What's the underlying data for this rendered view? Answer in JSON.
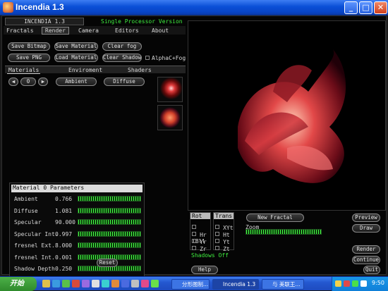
{
  "window": {
    "title": "Incendia 1.3",
    "min": "_",
    "max": "□",
    "close": "✕"
  },
  "header": {
    "app_name": "INCENDIA 1.3",
    "version": "Single Processor Version"
  },
  "menu": [
    "Fractals",
    "Render",
    "Camera",
    "Editors",
    "About"
  ],
  "toolbar": {
    "save_bitmap": "Save Bitmap",
    "save_material": "Save Material",
    "clear_fog": "Clear fog",
    "save_png": "Save PNG",
    "load_material": "Load Material",
    "clear_shadows": "Clear Shadows",
    "alpha_fog": "AlphaC+Fog"
  },
  "tabs": [
    "Materials",
    "Enviroment",
    "Shaders"
  ],
  "material_nav": {
    "prev": "◀",
    "index": "0",
    "next": "▶",
    "ambient": "Ambient",
    "diffuse": "Diffuse"
  },
  "params": {
    "title": "Material 0  Parameters",
    "rows": [
      {
        "label": "Ambient",
        "value": "0.766"
      },
      {
        "label": "Diffuse",
        "value": "1.081"
      },
      {
        "label": "Specular",
        "value": "90.000"
      },
      {
        "label": "Specular Int.",
        "value": "0.997"
      },
      {
        "label": "fresnel Ext.",
        "value": "8.000"
      },
      {
        "label": "fresnel Int.",
        "value": "0.001"
      },
      {
        "label": "Shadow Depth",
        "value": "0.250"
      }
    ],
    "reset": "Reset"
  },
  "controls": {
    "rot_title": "Rot",
    "trans_title": "Trans",
    "rot_items": [
      "TBll",
      "Hr",
      "Yr",
      "Zr"
    ],
    "trans_items": [
      "XYt",
      "Ht",
      "Yt",
      "Zt"
    ],
    "new_fractal": "New Fractal",
    "zoom": "Zoom",
    "shadows": "Shadows Off",
    "help": "Help",
    "preview": "Preview",
    "draw": "Draw",
    "render": "Render",
    "continue": "Continue",
    "quit": "Quit"
  },
  "taskbar": {
    "start": "开始",
    "tasks": [
      "分形图制...",
      "Incendia 1.3",
      "与 美联王..."
    ],
    "clock": "9:50"
  },
  "colors": {
    "accent_green": "#3fef3f",
    "fractal": "#c2303a"
  }
}
